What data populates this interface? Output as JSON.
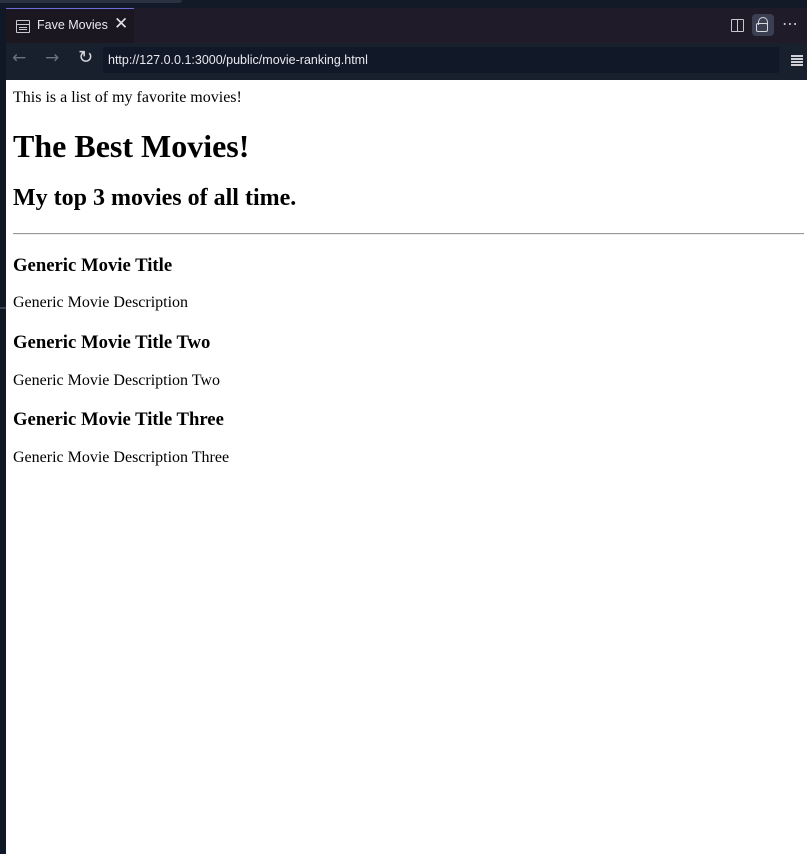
{
  "browser": {
    "tab_title": "Fave Movies",
    "tab_close": "✕",
    "url": "http://127.0.0.1:3000/public/movie-ranking.html",
    "icons": {
      "tab": "page-icon",
      "split": "split-editor-icon",
      "lock": "lock-icon",
      "more": "more-icon",
      "back": "back-arrow-icon",
      "forward": "forward-arrow-icon",
      "reload": "reload-icon",
      "menu": "menu-icon"
    }
  },
  "page": {
    "intro": "This is a list of my favorite movies!",
    "heading": "The Best Movies!",
    "subheading": "My top 3 movies of all time.",
    "movies": [
      {
        "title": "Generic Movie Title",
        "description": "Generic Movie Description"
      },
      {
        "title": "Generic Movie Title Two",
        "description": "Generic Movie Description Two"
      },
      {
        "title": "Generic Movie Title Three",
        "description": "Generic Movie Description Three"
      }
    ]
  }
}
